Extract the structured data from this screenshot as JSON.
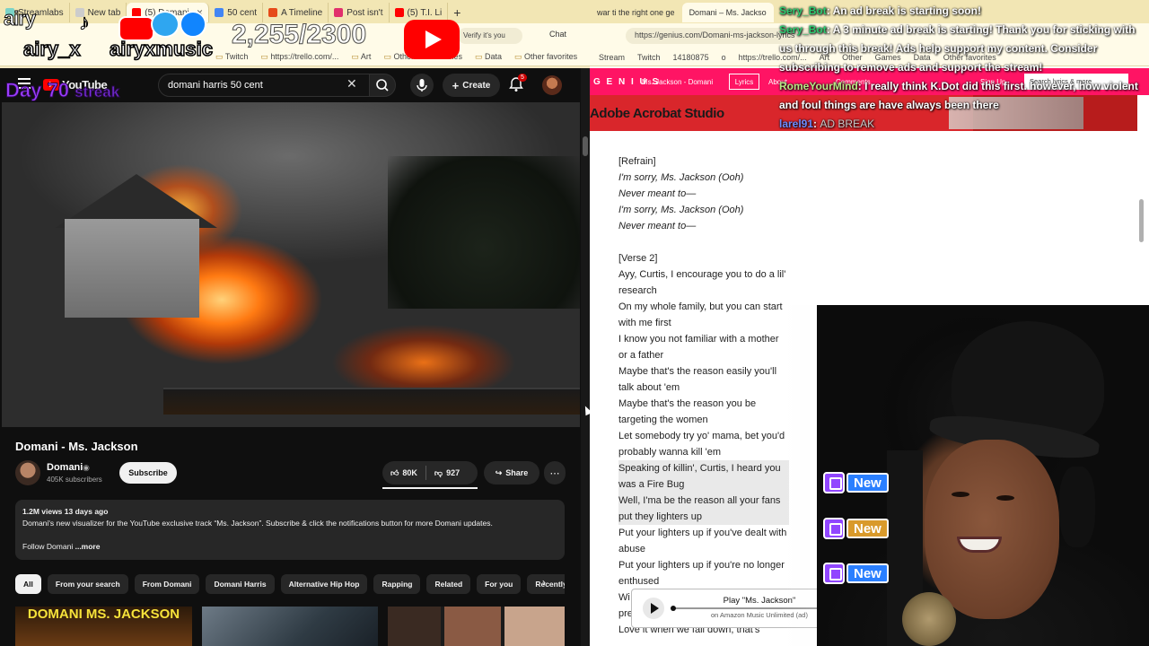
{
  "overlay": {
    "logo_text": "airy",
    "handle_left": "airy_x",
    "handle_right": "airyxmusic",
    "sub_counter": "2,255/2300",
    "streak_prefix": "Day 70",
    "streak_suffix": "streak"
  },
  "left_browser": {
    "tabs": [
      {
        "label": "Streamlabs",
        "color": "#7bd3c7"
      },
      {
        "label": "New tab",
        "color": "#cccccc"
      },
      {
        "label": "(5) Domani",
        "color": "#ff0000"
      },
      {
        "label": "50 cent",
        "color": "#4285f4"
      },
      {
        "label": "A Timeline",
        "color": "#e64a19"
      },
      {
        "label": "Post isn't",
        "color": "#e1306c"
      },
      {
        "label": "(5) T.I. Li",
        "color": "#ff0000"
      }
    ],
    "verify_text": "Verify it's you",
    "chat_button": "Chat",
    "bookmarks": [
      "Twitch",
      "https://trello.com/...",
      "Art",
      "Other",
      "Games",
      "Data",
      "Other favorites"
    ]
  },
  "youtube": {
    "logo": "YouTube",
    "search_query": "domani harris 50 cent",
    "create_label": "Create",
    "notification_count": "5",
    "video_title": "Domani - Ms. Jackson",
    "channel_name": "Domani",
    "subscribers": "405K subscribers",
    "subscribe_label": "Subscribe",
    "likes": "80K",
    "dislikes": "927",
    "share_label": "Share",
    "description": {
      "meta": "1.2M views  13 days ago",
      "text": "Domani's new visualizer for the YouTube exclusive track “Ms. Jackson”. Subscribe & click the notifications button for more Domani updates.",
      "follow": "Follow Domani",
      "more": "...more"
    },
    "chips": [
      "All",
      "From your search",
      "From Domani",
      "Domani Harris",
      "Alternative Hip Hop",
      "Rapping",
      "Related",
      "For you",
      "Recently"
    ],
    "thumbnail_text": "DOMANI MS. JACKSON"
  },
  "right_browser": {
    "tabs": [
      {
        "label": "war ti the right one ge"
      },
      {
        "label": "Domani – Ms. Jackso"
      }
    ],
    "url": "https://genius.com/Domani-ms-jackson-lyrics",
    "bookmarks": [
      "Stream",
      "Twitch",
      "14180875",
      "o",
      "https://trello.com/...",
      "Art",
      "Other",
      "Games",
      "Data",
      "Other favorites"
    ],
    "genius": {
      "logo": "G E N I U S",
      "song": "Ms. Jackson - Domani",
      "lyrics_tab": "Lyrics",
      "about_tab": "About",
      "comments_tab": "Comments",
      "sign_up": "Sign Up",
      "search_placeholder": "Search lyrics & more",
      "ad_text": "Adobe Acrobat Studio"
    },
    "lyrics": [
      {
        "text": "[Refrain]",
        "style": "plain"
      },
      {
        "text": "I'm sorry, Ms. Jackson (Ooh)",
        "style": "italic"
      },
      {
        "text": "Never meant to—",
        "style": "italic"
      },
      {
        "text": "I'm sorry, Ms. Jackson (Ooh)",
        "style": "italic"
      },
      {
        "text": "Never meant to—",
        "style": "italic"
      },
      {
        "text": "",
        "style": "gap"
      },
      {
        "text": "[Verse 2]",
        "style": "plain"
      },
      {
        "text": "Ayy, Curtis, I encourage you to do a lil' research",
        "style": "plain"
      },
      {
        "text": "On my whole family, but you can start with me first",
        "style": "plain"
      },
      {
        "text": "I know you not familiar with a mother or a father",
        "style": "plain"
      },
      {
        "text": "Maybe that's the reason easily you'll talk about 'em",
        "style": "plain"
      },
      {
        "text": "Maybe that's the reason you be targeting the women",
        "style": "plain"
      },
      {
        "text": "Let somebody try yo' mama, bet you'd probably wanna kill 'em",
        "style": "plain"
      },
      {
        "text": "Speaking of killin', Curtis, I heard you was a Fire Bug",
        "style": "highlight"
      },
      {
        "text": "Well, I'ma be the reason all your fans put they lighters up",
        "style": "highlight"
      },
      {
        "text": "Put your lighters up if you've dealt with abuse",
        "style": "plain"
      },
      {
        "text": "Put your lighters up if you're no longer enthused",
        "style": "plain"
      },
      {
        "text": "Wi",
        "style": "plain"
      },
      {
        "text": "pre",
        "style": "plain"
      },
      {
        "text": "Love it when we fall down, that's",
        "style": "plain"
      }
    ],
    "music_widget": {
      "title": "Play \"Ms. Jackson\"",
      "subtitle": "on Amazon Music Unlimited (ad)"
    }
  },
  "chat": [
    {
      "user": "Sery_Bot",
      "sep": ":",
      "msg": "An ad break is starting soon!",
      "cls": "u2"
    },
    {
      "user": "Sery_Bot",
      "sep": ":",
      "msg": "A 3 minute ad break is starting! Thank you for sticking with us through this break! Ads help support my content. Consider subscribing to remove ads and support the stream!",
      "cls": "u2"
    },
    {
      "user": "RomeYourMind",
      "sep": ":",
      "msg": "I really think K.Dot did this first. however, how violent and foul things are have always been there",
      "cls": "u4"
    },
    {
      "user": "larel91",
      "sep": ":",
      "msg": "AD BREAK",
      "cls": "u3"
    }
  ],
  "alerts": [
    "New",
    "New",
    "New"
  ]
}
